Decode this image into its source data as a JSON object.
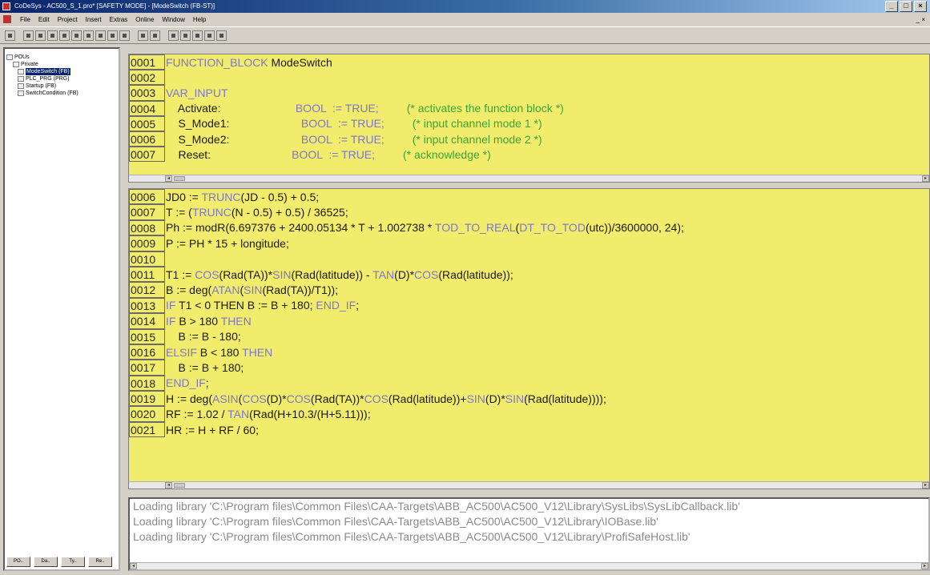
{
  "window": {
    "title": "CoDeSys - AC500_S_1.pro* [SAFETY MODE] - [ModeSwitch (FB-ST)]",
    "buttons": [
      "_",
      "□",
      "×"
    ]
  },
  "menubar": {
    "items": [
      "File",
      "Edit",
      "Project",
      "Insert",
      "Extras",
      "Online",
      "Window",
      "Help"
    ],
    "mdi_buttons": "_ ×"
  },
  "tree": {
    "items": [
      {
        "label": "POUs",
        "level": 0,
        "selected": false
      },
      {
        "label": "Private",
        "level": 1,
        "selected": false
      },
      {
        "label": "ModeSwitch (FB)",
        "level": 2,
        "selected": true
      },
      {
        "label": "PLC_PRG (PRG)",
        "level": 2,
        "selected": false
      },
      {
        "label": "Startup (FB)",
        "level": 2,
        "selected": false
      },
      {
        "label": "SwitchCondition (FB)",
        "level": 2,
        "selected": false
      }
    ],
    "tabs": [
      "PO..",
      "Da..",
      "Ty..",
      "Re.."
    ]
  },
  "editor_top": {
    "lines": [
      {
        "num": "0001",
        "segs": [
          {
            "t": "FUNCTION_BLOCK ",
            "c": "kw"
          },
          {
            "t": "ModeSwitch",
            "c": ""
          }
        ]
      },
      {
        "num": "0002",
        "segs": []
      },
      {
        "num": "0003",
        "segs": [
          {
            "t": "VAR_INPUT",
            "c": "kw"
          }
        ]
      },
      {
        "num": "0004",
        "segs": [
          {
            "t": "    Activate:",
            "c": ""
          },
          {
            "t": "                        BOOL  := TRUE;",
            "c": "val"
          },
          {
            "t": "         (* activates the function block *)",
            "c": "cm"
          }
        ]
      },
      {
        "num": "0005",
        "segs": [
          {
            "t": "    S_Mode1:",
            "c": ""
          },
          {
            "t": "                       BOOL  := TRUE;",
            "c": "val"
          },
          {
            "t": "         (* input channel mode 1 *)",
            "c": "cm"
          }
        ]
      },
      {
        "num": "0006",
        "segs": [
          {
            "t": "    S_Mode2:",
            "c": ""
          },
          {
            "t": "                       BOOL  := TRUE;",
            "c": "val"
          },
          {
            "t": "         (* input channel mode 2 *)",
            "c": "cm"
          }
        ]
      },
      {
        "num": "0007",
        "segs": [
          {
            "t": "    Reset:",
            "c": ""
          },
          {
            "t": "                          BOOL  := TRUE;",
            "c": "val"
          },
          {
            "t": "         (* acknowledge *)",
            "c": "cm"
          }
        ]
      }
    ]
  },
  "editor_bottom": {
    "lines": [
      {
        "num": "0006",
        "segs": [
          {
            "t": "JD0 := ",
            "c": ""
          },
          {
            "t": "TRUNC",
            "c": "fn"
          },
          {
            "t": "(JD - 0.5) + 0.5;",
            "c": ""
          }
        ]
      },
      {
        "num": "0007",
        "segs": [
          {
            "t": "T := (",
            "c": ""
          },
          {
            "t": "TRUNC",
            "c": "fn"
          },
          {
            "t": "(N - 0.5) + 0.5) / 36525;",
            "c": ""
          }
        ]
      },
      {
        "num": "0008",
        "segs": [
          {
            "t": "Ph := modR(6.697376 + 2400.05134 * T + 1.002738 * ",
            "c": ""
          },
          {
            "t": "TOD_TO_REAL",
            "c": "fn"
          },
          {
            "t": "(",
            "c": ""
          },
          {
            "t": "DT_TO_TOD",
            "c": "fn"
          },
          {
            "t": "(utc))/3600000, 24);",
            "c": ""
          }
        ]
      },
      {
        "num": "0009",
        "segs": [
          {
            "t": "P := PH * 15 + longitude;",
            "c": ""
          }
        ]
      },
      {
        "num": "0010",
        "segs": []
      },
      {
        "num": "0011",
        "segs": [
          {
            "t": "T1 := ",
            "c": ""
          },
          {
            "t": "COS",
            "c": "fn"
          },
          {
            "t": "(Rad(TA))*",
            "c": ""
          },
          {
            "t": "SIN",
            "c": "fn"
          },
          {
            "t": "(Rad(latitude)) - ",
            "c": ""
          },
          {
            "t": "TAN",
            "c": "fn"
          },
          {
            "t": "(D)*",
            "c": ""
          },
          {
            "t": "COS",
            "c": "fn"
          },
          {
            "t": "(Rad(latitude));",
            "c": ""
          }
        ]
      },
      {
        "num": "0012",
        "segs": [
          {
            "t": "B := deg(",
            "c": ""
          },
          {
            "t": "ATAN",
            "c": "fn"
          },
          {
            "t": "(",
            "c": ""
          },
          {
            "t": "SIN",
            "c": "fn"
          },
          {
            "t": "(Rad(TA))/T1));",
            "c": ""
          }
        ]
      },
      {
        "num": "0013",
        "segs": [
          {
            "t": "IF ",
            "c": "kw"
          },
          {
            "t": "T1 < 0 THEN B := B + 180; ",
            "c": ""
          },
          {
            "t": "END_IF",
            "c": "kw"
          },
          {
            "t": ";",
            "c": ""
          }
        ]
      },
      {
        "num": "0014",
        "segs": [
          {
            "t": "IF ",
            "c": "kw"
          },
          {
            "t": "B > 180 ",
            "c": ""
          },
          {
            "t": "THEN",
            "c": "kw"
          }
        ]
      },
      {
        "num": "0015",
        "segs": [
          {
            "t": "    B := B - 180;",
            "c": ""
          }
        ]
      },
      {
        "num": "0016",
        "segs": [
          {
            "t": "ELSIF ",
            "c": "kw"
          },
          {
            "t": "B < 180 ",
            "c": ""
          },
          {
            "t": "THEN",
            "c": "kw"
          }
        ]
      },
      {
        "num": "0017",
        "segs": [
          {
            "t": "    B := B + 180;",
            "c": ""
          }
        ]
      },
      {
        "num": "0018",
        "segs": [
          {
            "t": "END_IF",
            "c": "kw"
          },
          {
            "t": ";",
            "c": ""
          }
        ]
      },
      {
        "num": "0019",
        "segs": [
          {
            "t": "H := deg(",
            "c": ""
          },
          {
            "t": "ASIN",
            "c": "fn"
          },
          {
            "t": "(",
            "c": ""
          },
          {
            "t": "COS",
            "c": "fn"
          },
          {
            "t": "(D)*",
            "c": ""
          },
          {
            "t": "COS",
            "c": "fn"
          },
          {
            "t": "(Rad(TA))*",
            "c": ""
          },
          {
            "t": "COS",
            "c": "fn"
          },
          {
            "t": "(Rad(latitude))+",
            "c": ""
          },
          {
            "t": "SIN",
            "c": "fn"
          },
          {
            "t": "(D)*",
            "c": ""
          },
          {
            "t": "SIN",
            "c": "fn"
          },
          {
            "t": "(Rad(latitude))));",
            "c": ""
          }
        ]
      },
      {
        "num": "0020",
        "segs": [
          {
            "t": "RF := 1.02 / ",
            "c": ""
          },
          {
            "t": "TAN",
            "c": "fn"
          },
          {
            "t": "(Rad(H+10.3/(H+5.11)));",
            "c": ""
          }
        ]
      },
      {
        "num": "0021",
        "segs": [
          {
            "t": "HR := H + RF / 60;",
            "c": ""
          }
        ]
      }
    ]
  },
  "output": {
    "lines": [
      "Loading library 'C:\\Program files\\Common Files\\CAA-Targets\\ABB_AC500\\AC500_V12\\Library\\SysLibs\\SysLibCallback.lib'",
      "Loading library 'C:\\Program files\\Common Files\\CAA-Targets\\ABB_AC500\\AC500_V12\\Library\\IOBase.lib'",
      "Loading library 'C:\\Program files\\Common Files\\CAA-Targets\\ABB_AC500\\AC500_V12\\Library\\ProfiSafeHost.lib'"
    ]
  },
  "colors": {
    "editor_bg": "#f2ec6c",
    "keyword": "#7c76cc",
    "comment": "#3aa53a",
    "selection": "#0a246a"
  }
}
